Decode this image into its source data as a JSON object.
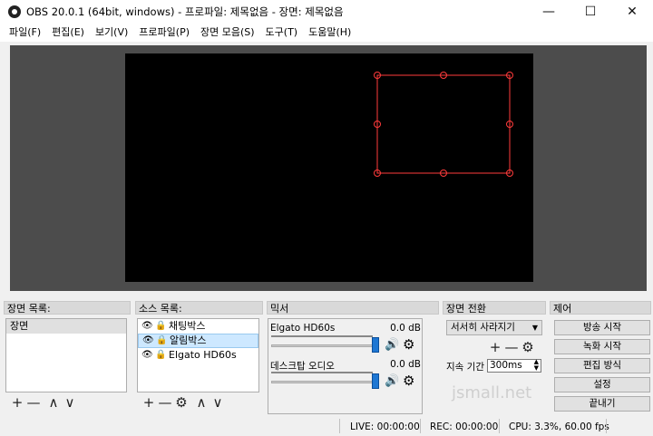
{
  "window": {
    "title": "OBS 20.0.1 (64bit, windows) - 프로파일: 제목없음 - 장면: 제목없음",
    "minimize": "—",
    "maximize": "☐",
    "close": "✕"
  },
  "menu": [
    "파일(F)",
    "편집(E)",
    "보기(V)",
    "프로파일(P)",
    "장면 모음(S)",
    "도구(T)",
    "도움말(H)"
  ],
  "docks": {
    "scenes_title": "장면 목록:",
    "sources_title": "소스 목록:",
    "mixer_title": "믹서",
    "transitions_title": "장면 전환",
    "controls_title": "제어"
  },
  "scenes": [
    "장면"
  ],
  "sources": [
    {
      "name": "채팅박스"
    },
    {
      "name": "알림박스"
    },
    {
      "name": "Elgato HD60s"
    }
  ],
  "toolbar_glyphs": {
    "add": "+",
    "remove": "—",
    "up": "∧",
    "down": "∨",
    "gear": "⚙"
  },
  "mixer": [
    {
      "name": "Elgato HD60s",
      "db": "0.0 dB"
    },
    {
      "name": "데스크탑 오디오",
      "db": "0.0 dB"
    }
  ],
  "transitions": {
    "selected": "서서히 사라지기",
    "duration_label": "지속 기간",
    "duration_value": "300ms"
  },
  "controls": [
    "방송 시작",
    "녹화 시작",
    "편집 방식",
    "설정",
    "끝내기"
  ],
  "status": {
    "live": "LIVE: 00:00:00",
    "rec": "REC: 00:00:00",
    "cpu": "CPU: 3.3%, 60.00 fps"
  },
  "watermark": "jsmall.net",
  "colors": {
    "selection": "#ff3b3b",
    "preview_bg": "#4c4c4c",
    "slider": "#1e77d3"
  }
}
